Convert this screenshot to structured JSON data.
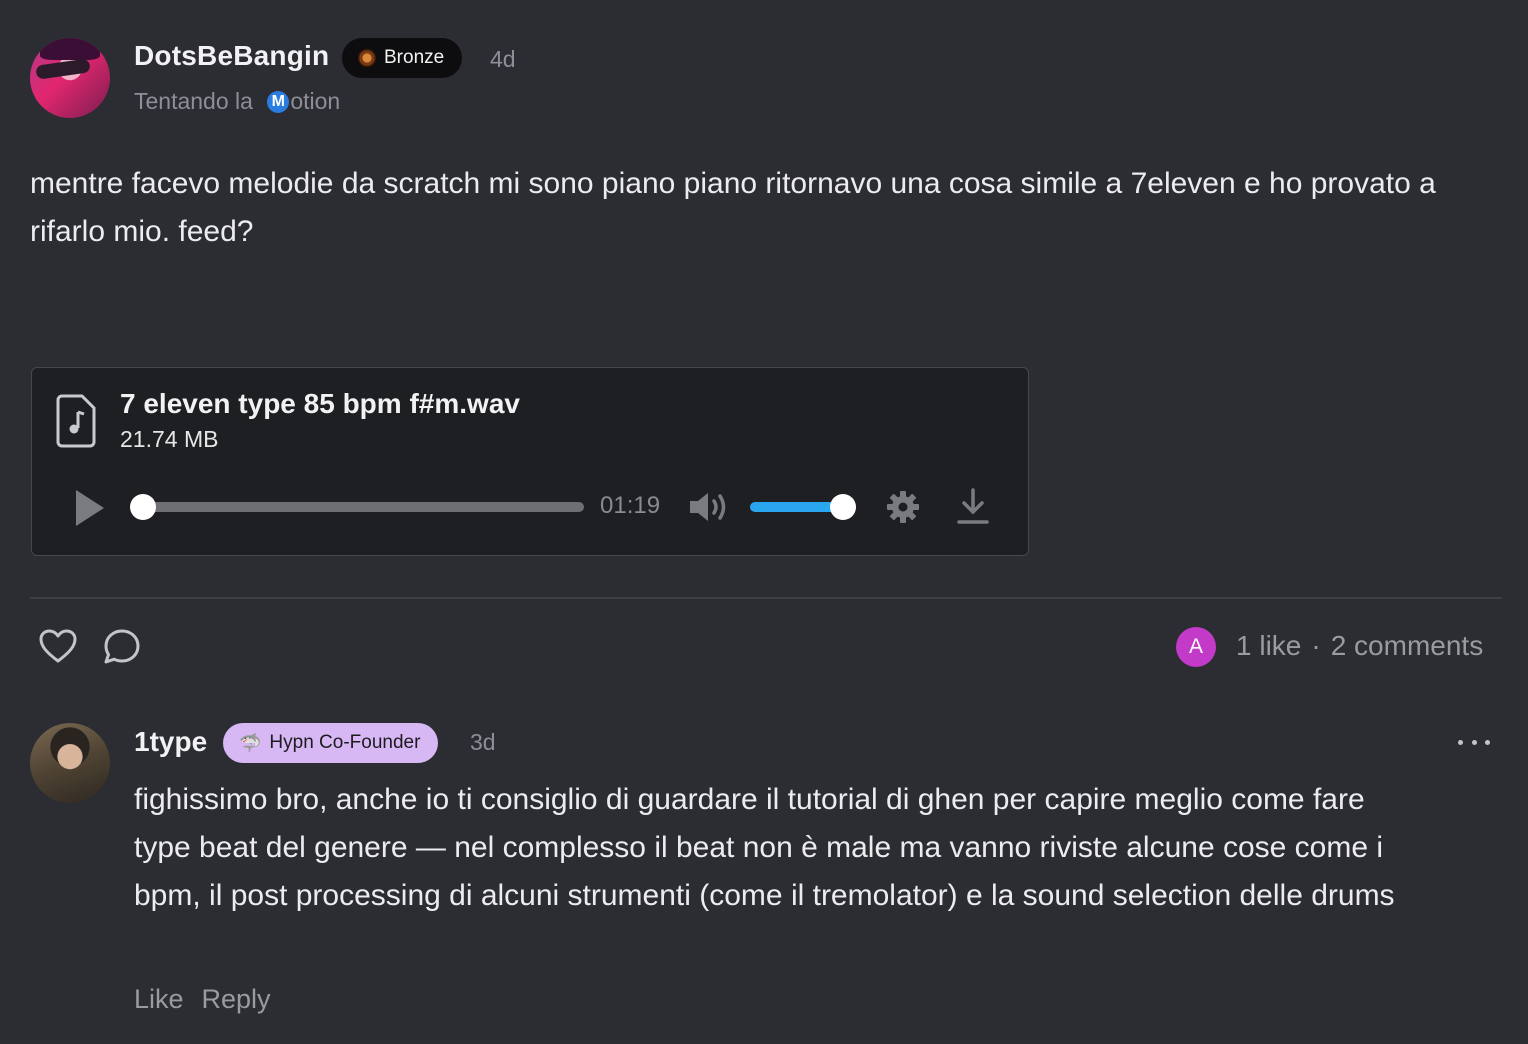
{
  "post": {
    "author": "DotsBeBangin",
    "badge": "Bronze",
    "time": "4d",
    "subtitle_prefix": "Tentando la ",
    "subtitle_icon_letter": "M",
    "subtitle_suffix": "otion",
    "body": "mentre facevo melodie da scratch mi sono piano piano ritornavo una cosa simile a 7eleven e ho provato a rifarlo mio. feed?"
  },
  "attachment": {
    "file_name": "7 eleven type 85 bpm f#m.wav",
    "file_size": "21.74 MB",
    "time_remaining": "01:19",
    "progress": 0,
    "volume": 1.0,
    "icons": [
      "music-file-icon",
      "play-icon",
      "volume-icon",
      "gear-icon",
      "download-icon"
    ]
  },
  "actions": {
    "liker_initial": "A",
    "likes": "1 like",
    "separator": "·",
    "comments": "2 comments",
    "icons": [
      "heart-icon",
      "comment-icon"
    ]
  },
  "comment": {
    "author": "1type",
    "badge_icon": "🦈",
    "badge": "Hypn Co-Founder",
    "time": "3d",
    "body": "fighissimo bro, anche io ti consiglio di guardare il tutorial di ghen per capire meglio come fare type beat del genere — nel complesso il beat non è male ma vanno riviste alcune cose come i bpm, il post processing di alcuni strumenti (come il tremolator) e la sound selection delle drums",
    "like_label": "Like",
    "reply_label": "Reply"
  },
  "colors": {
    "background": "#2b2d33",
    "card": "#1e1f23",
    "volume_accent": "#2aa6ee",
    "cofounder_badge": "#d8b8f4",
    "liker_avatar": "#c23ac7"
  }
}
